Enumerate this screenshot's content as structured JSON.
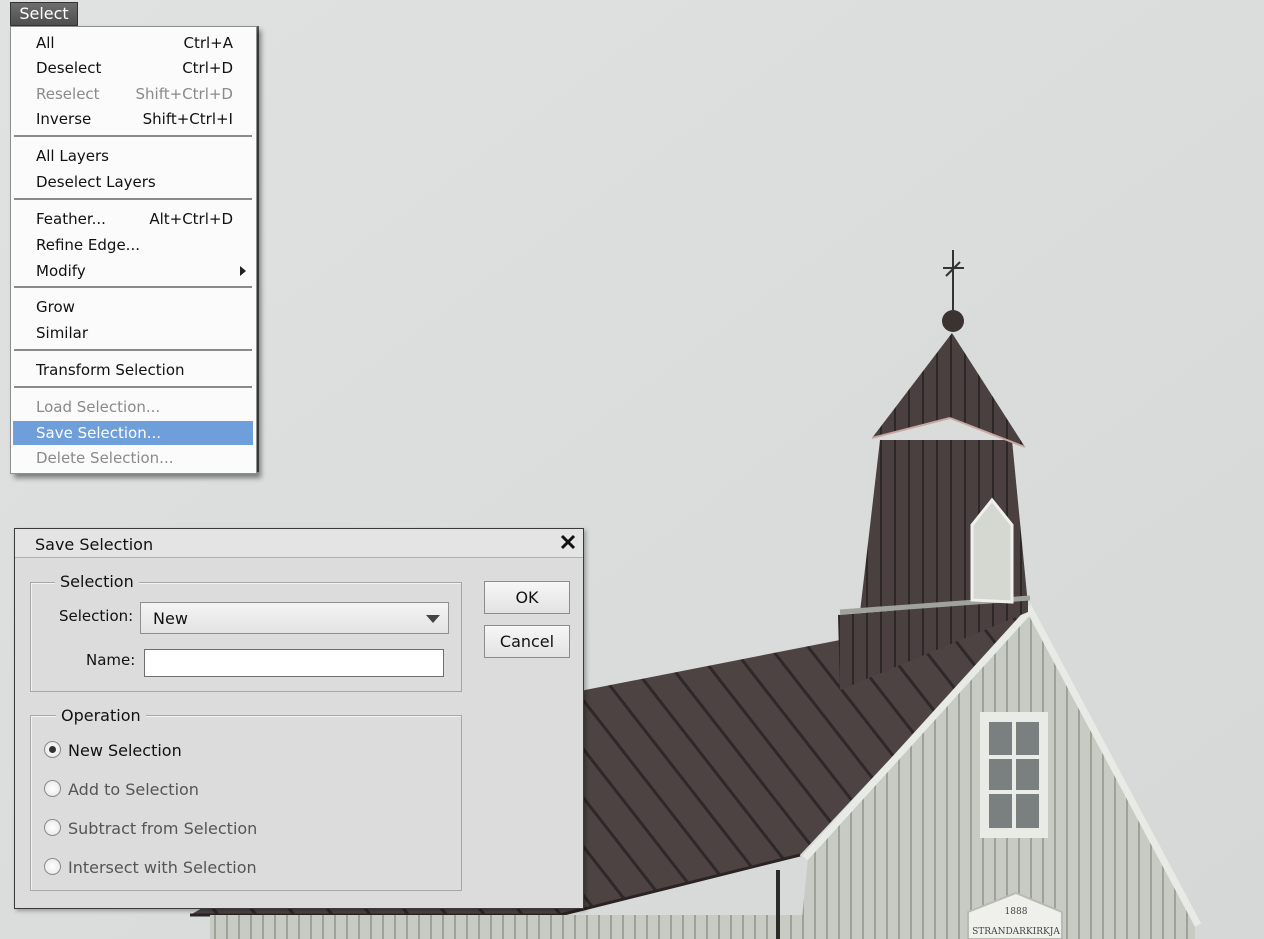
{
  "menu": {
    "title": "Select",
    "items": [
      {
        "label": "All",
        "shortcut": "Ctrl+A"
      },
      {
        "label": "Deselect",
        "shortcut": "Ctrl+D"
      },
      {
        "label": "Reselect",
        "shortcut": "Shift+Ctrl+D"
      },
      {
        "label": "Inverse",
        "shortcut": "Shift+Ctrl+I"
      },
      {
        "label": "All Layers"
      },
      {
        "label": "Deselect Layers"
      },
      {
        "label": "Feather...",
        "shortcut": "Alt+Ctrl+D"
      },
      {
        "label": "Refine Edge..."
      },
      {
        "label": "Modify"
      },
      {
        "label": "Grow"
      },
      {
        "label": "Similar"
      },
      {
        "label": "Transform Selection"
      },
      {
        "label": "Load Selection..."
      },
      {
        "label": "Save Selection..."
      },
      {
        "label": "Delete Selection..."
      }
    ]
  },
  "dialog": {
    "title": "Save Selection",
    "selection_group": {
      "legend": "Selection",
      "selection_label": "Selection:",
      "selection_value": "New",
      "name_label": "Name:",
      "name_value": ""
    },
    "ok_label": "OK",
    "cancel_label": "Cancel",
    "operation_group": {
      "legend": "Operation",
      "options": [
        {
          "label": "New Selection",
          "checked": true
        },
        {
          "label": "Add to Selection",
          "checked": false
        },
        {
          "label": "Subtract from Selection",
          "checked": false
        },
        {
          "label": "Intersect with Selection",
          "checked": false
        }
      ]
    }
  },
  "photo": {
    "sign_year": "1888",
    "sign_name": "STRANDARKIRKJA"
  },
  "colors": {
    "menu_highlight": "#6e9fdb",
    "sky": "#e2e3e3",
    "roof": "#4a3f3f",
    "wall": "#c9ccc4"
  }
}
